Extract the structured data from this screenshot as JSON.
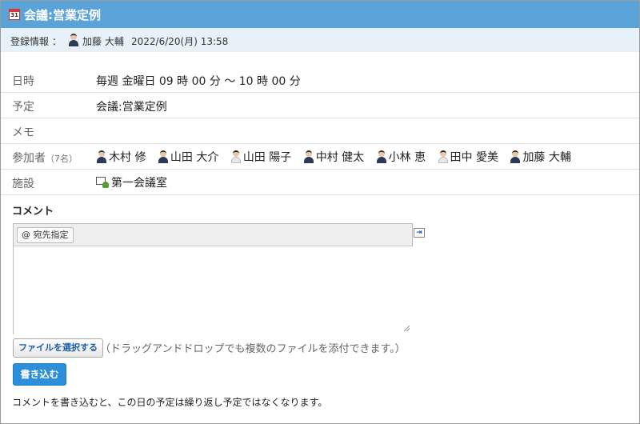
{
  "title": "会議:営業定例",
  "calendar_icon_text": "31",
  "registration": {
    "label": "登録情報 ：",
    "user": "加藤 大輔",
    "datetime": "2022/6/20(月) 13:58"
  },
  "rows": {
    "datetime": {
      "label": "日時",
      "value": "毎週 金曜日 09 時 00 分 〜 10 時 00 分"
    },
    "schedule": {
      "label": "予定",
      "value": "会議:営業定例"
    },
    "memo": {
      "label": "メモ",
      "value": ""
    },
    "participants": {
      "label": "参加者",
      "count": "（7名）",
      "members": [
        "木村 修",
        "山田 大介",
        "山田 陽子",
        "中村 健太",
        "小林 恵",
        "田中 愛美",
        "加藤 大輔"
      ]
    },
    "facility": {
      "label": "施設",
      "value": "第一会議室"
    }
  },
  "comment": {
    "heading": "コメント",
    "mention_button": "@ 宛先指定",
    "expand_icon": "expand-right-icon",
    "file_button": "ファイルを選択する",
    "file_hint": "（ドラッグアンドドロップでも複数のファイルを添付できます。）",
    "submit_button": "書き込む",
    "note": "コメントを書き込むと、この日の予定は繰り返し予定ではなくなります。"
  }
}
